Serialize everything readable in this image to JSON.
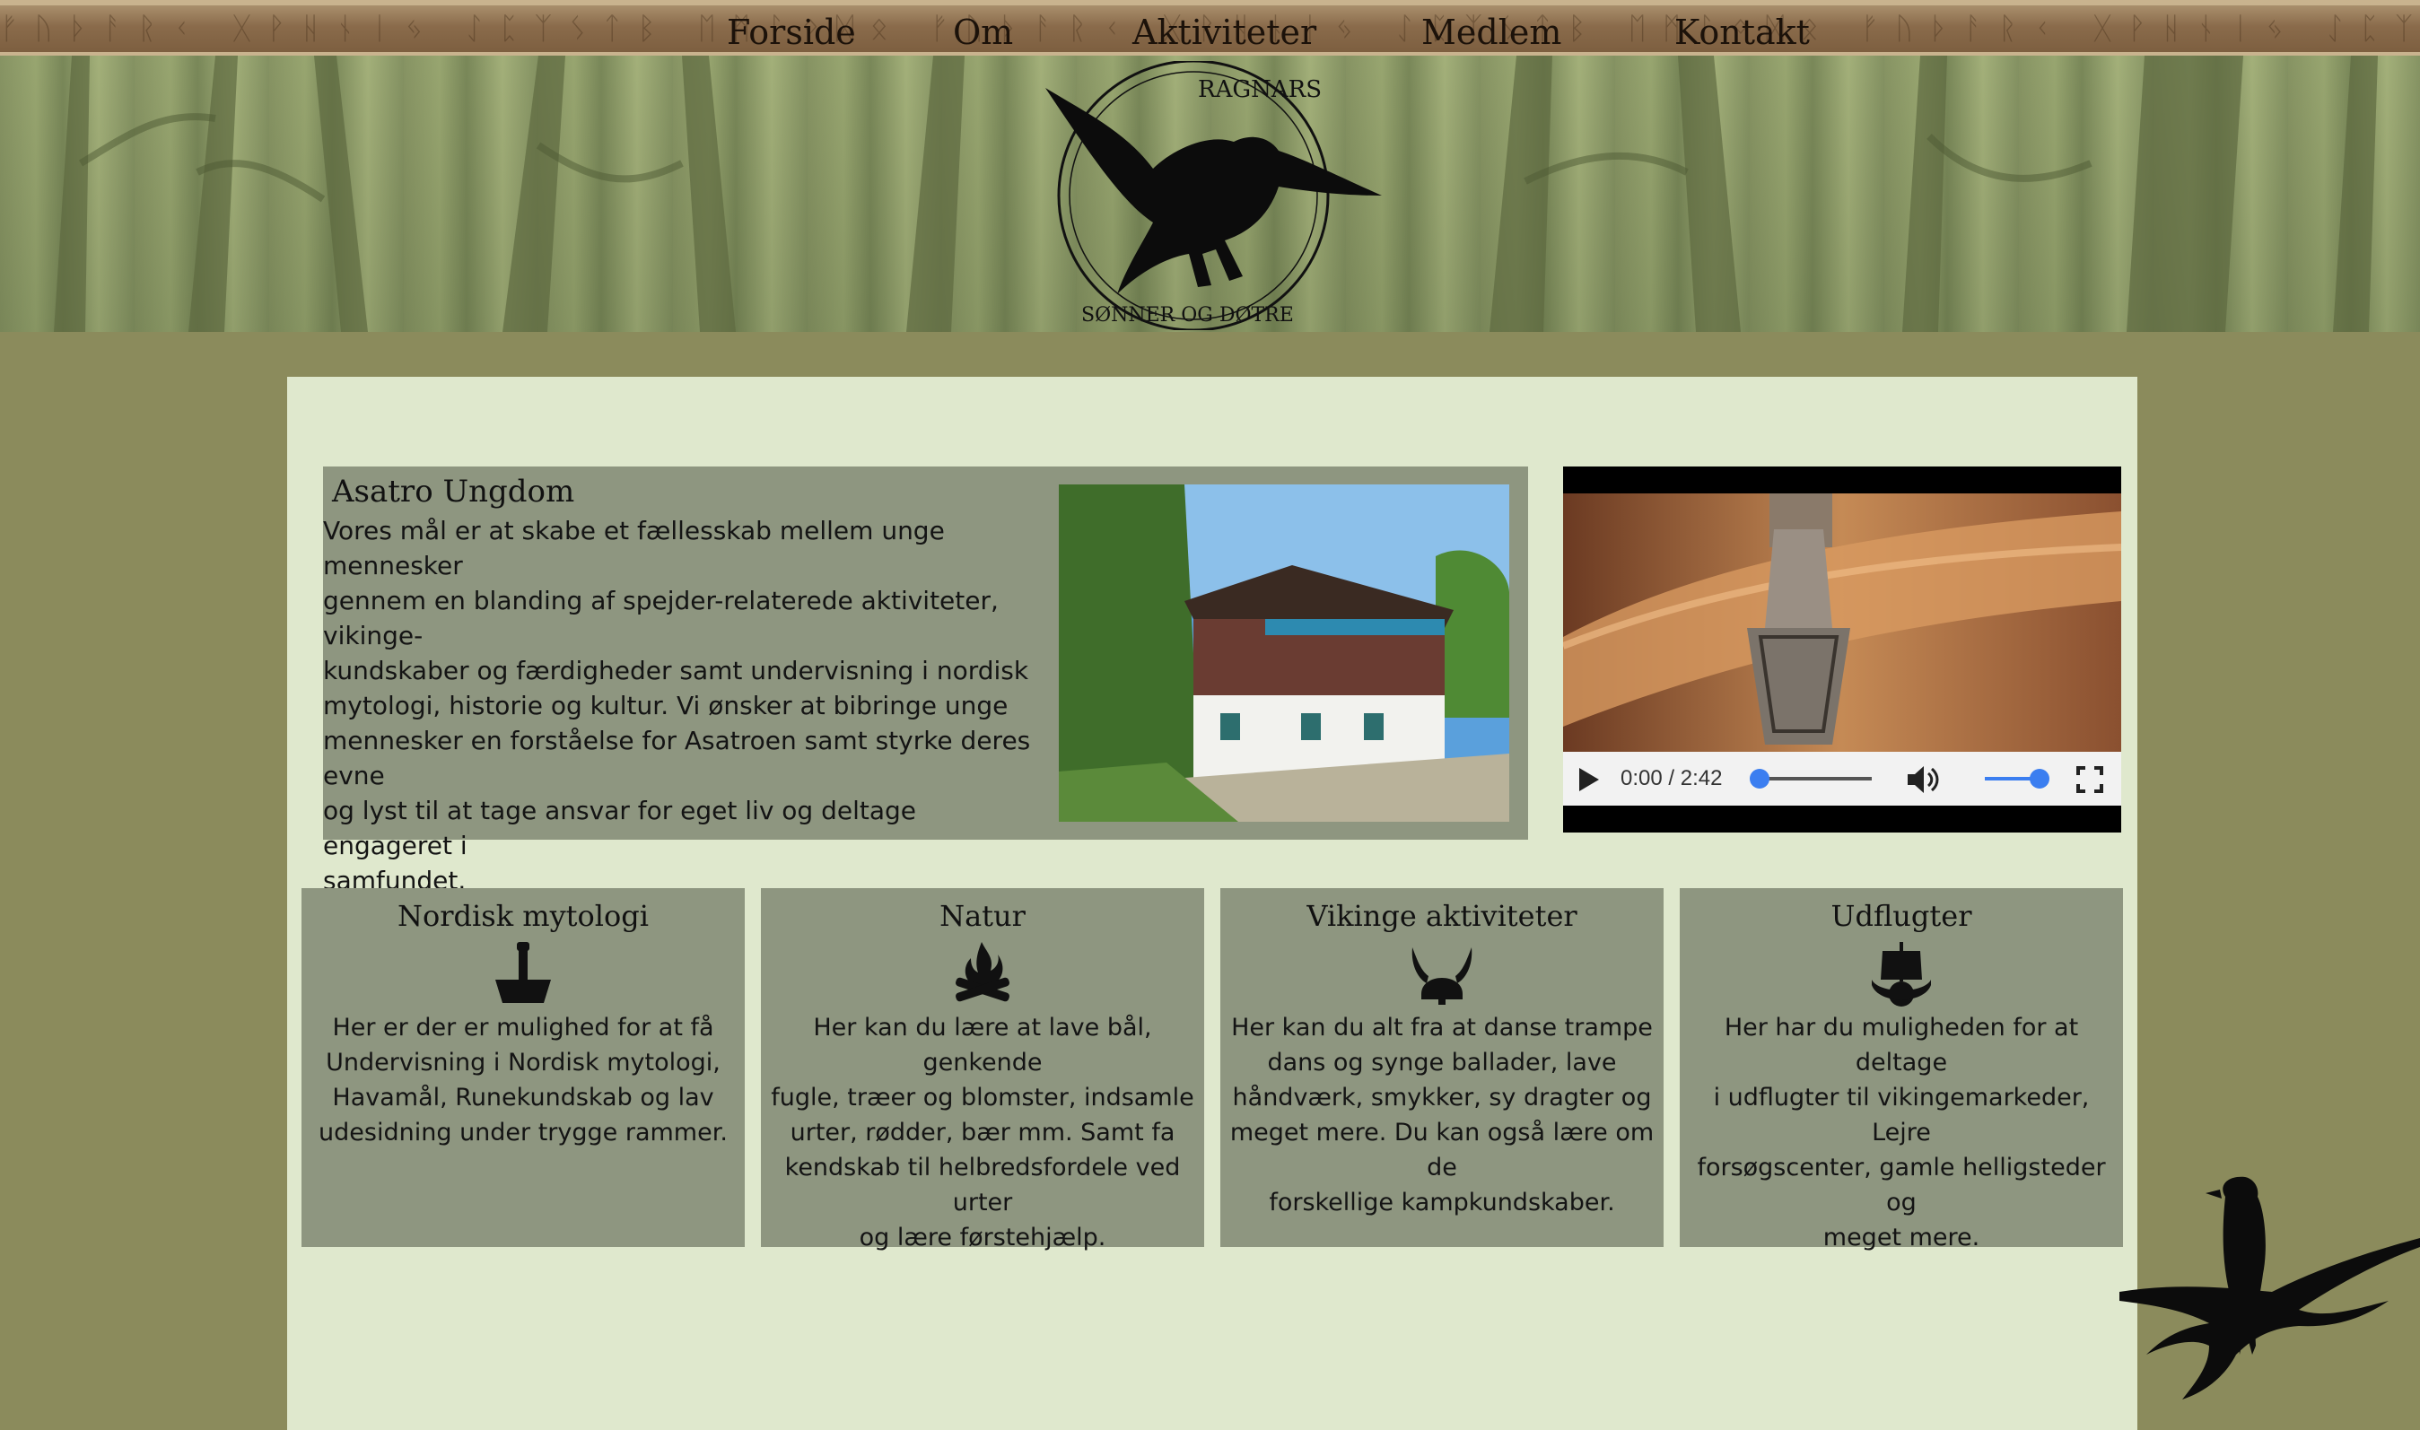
{
  "nav": {
    "items": [
      "Forside",
      "Om",
      "Aktiviteter",
      "Medlem",
      "Kontakt"
    ],
    "runes": "ᚠᚢᚦᚨᚱᚲ ᚷᚹᚺᚾᛁᛃ ᛇᛈᛉᛊᛏᛒ ᛖᛗᛚᛜᛞᛟ ᚠᚢᚦᚨᚱᚲ ᚷᚹᚺᚾᛁᛃ ᛇᛈᛉᛊᛏᛒ ᛖᛗᛚᛜᛞᛟ ᚠᚢᚦᚨᚱᚲ ᚷᚹᚺᚾᛁᛃ ᛇᛈᛉᛊᛏᛒ ᛖᛗᛚᛜᛞᛟ"
  },
  "logo": {
    "text_top": "RAGNARS",
    "text_bottom": "SØNNER OG DØTRE"
  },
  "about": {
    "title": "Asatro Ungdom",
    "text_lines": [
      "Vores mål er at skabe et fællesskab mellem unge mennesker",
      "gennem en blanding af spejder-relaterede aktiviteter, vikinge-",
      "kundskaber og færdigheder samt undervisning i nordisk",
      "mytologi, historie og kultur. Vi ønsker at bibringe unge",
      "mennesker en forståelse for Asatroen samt styrke deres evne",
      "og lyst til at tage ansvar for eget liv og deltage engageret i",
      "samfundet."
    ]
  },
  "video": {
    "time": "0:00 / 2:42",
    "progress": 0,
    "volume": 1
  },
  "cards": [
    {
      "title": "Nordisk mytologi",
      "icon": "thors-hammer-icon",
      "text_lines": [
        "Her er der er mulighed for at få",
        "Undervisning i Nordisk mytologi,",
        "Havamål, Runekundskab og lav",
        "udesidning under trygge rammer."
      ]
    },
    {
      "title": "Natur",
      "icon": "campfire-icon",
      "text_lines": [
        "Her kan du lære at lave bål, genkende",
        "fugle, træer og blomster, indsamle",
        "urter, rødder, bær mm. Samt fa",
        "kendskab til helbredsfordele ved urter",
        "og lære førstehjælp."
      ]
    },
    {
      "title": "Vikinge aktiviteter",
      "icon": "viking-helmet-icon",
      "text_lines": [
        "Her kan du alt fra at danse trampe",
        "dans og synge ballader, lave",
        "håndværk, smykker, sy dragter og",
        "meget mere. Du kan også lære om de",
        "forskellige kampkundskaber."
      ]
    },
    {
      "title": "Udflugter",
      "icon": "viking-ship-icon",
      "text_lines": [
        "Her har du muligheden for at deltage",
        "i udflugter til vikingemarkeder, Lejre",
        "forsøgscenter, gamle helligsteder og",
        "meget mere."
      ]
    }
  ],
  "colors": {
    "page_bg": "#8b8b5c",
    "panel_bg": "#dfe8cd",
    "box_bg": "#8e9680",
    "accent_blue": "#3b7ef0"
  }
}
